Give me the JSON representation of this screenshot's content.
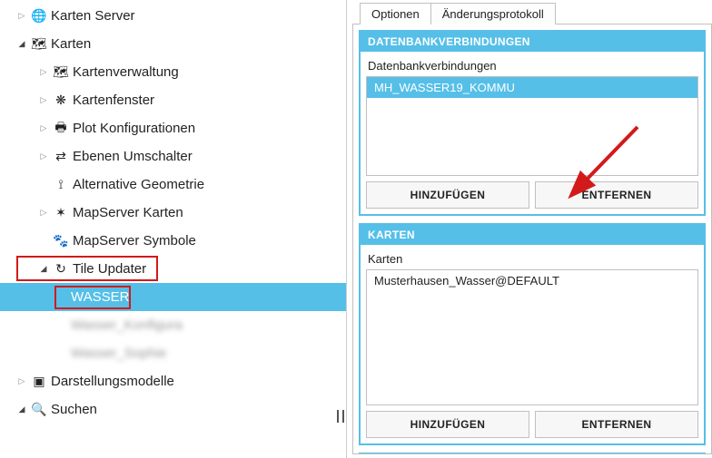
{
  "tree": {
    "items": [
      {
        "label": "Karten Server",
        "icon": "🌐",
        "expander": "collapsed",
        "level": 0
      },
      {
        "label": "Karten",
        "icon": "🗺",
        "expander": "expanded",
        "level": 0
      },
      {
        "label": "Kartenverwaltung",
        "icon": "🗺",
        "expander": "collapsed",
        "level": 1
      },
      {
        "label": "Kartenfenster",
        "icon": "❋",
        "expander": "collapsed",
        "level": 1
      },
      {
        "label": "Plot Konfigurationen",
        "icon": "🖶",
        "expander": "collapsed",
        "level": 1
      },
      {
        "label": "Ebenen Umschalter",
        "icon": "⇄",
        "expander": "collapsed",
        "level": 1
      },
      {
        "label": "Alternative Geometrie",
        "icon": "⟟",
        "expander": "none",
        "level": 1
      },
      {
        "label": "MapServer Karten",
        "icon": "✶",
        "expander": "collapsed",
        "level": 1
      },
      {
        "label": "MapServer Symbole",
        "icon": "🐾",
        "expander": "none",
        "level": 1
      },
      {
        "label": "Tile Updater",
        "icon": "↻",
        "expander": "expanded",
        "level": 1
      },
      {
        "label": "WASSER",
        "icon": "",
        "expander": "none",
        "level": 2,
        "selected": true
      },
      {
        "label": "Wasser_Konfigura",
        "icon": "",
        "expander": "none",
        "level": 2,
        "blurred": true
      },
      {
        "label": "Wasser_Sophie",
        "icon": "",
        "expander": "none",
        "level": 2,
        "blurred": true
      },
      {
        "label": "Darstellungsmodelle",
        "icon": "▣",
        "expander": "collapsed",
        "level": 0
      },
      {
        "label": "Suchen",
        "icon": "🔍",
        "expander": "expanded",
        "level": 0
      }
    ]
  },
  "tabs": {
    "optionen": "Optionen",
    "protokoll": "Änderungsprotokoll"
  },
  "db_section": {
    "header": "DATENBANKVERBINDUNGEN",
    "sublabel": "Datenbankverbindungen",
    "items": [
      {
        "label": "MH_WASSER19_KOMMU",
        "selected": true
      }
    ],
    "add": "HINZUFÜGEN",
    "remove": "ENTFERNEN"
  },
  "karten_section": {
    "header": "KARTEN",
    "sublabel": "Karten",
    "items": [
      {
        "label": "Musterhausen_Wasser@DEFAULT",
        "selected": false
      }
    ],
    "add": "HINZUFÜGEN",
    "remove": "ENTFERNEN"
  }
}
